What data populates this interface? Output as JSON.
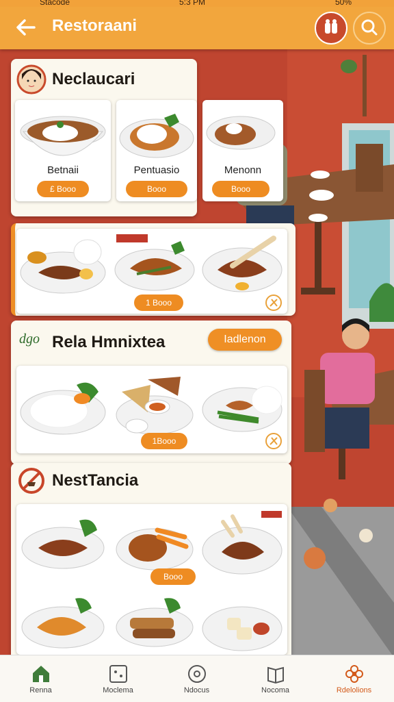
{
  "status": {
    "carrier": "Stacode",
    "time": "5:3 PM",
    "battery": "50%"
  },
  "header": {
    "title": "Restoraani"
  },
  "sections": [
    {
      "title": "Neclaucari",
      "dishes": [
        {
          "name": "Betnaii",
          "price": "£ Booo"
        },
        {
          "name": "Pentuasio",
          "price": "Booo"
        },
        {
          "name": "Menonn",
          "price": "Booo"
        }
      ]
    },
    {
      "title": "",
      "dishes": [
        {
          "name": "",
          "price": ""
        },
        {
          "name": "",
          "price": "1 Booo"
        },
        {
          "name": "",
          "price": ""
        }
      ]
    },
    {
      "title": "Rela Hmnixtea",
      "logo_text": "dgo",
      "action": "Iadlenon",
      "dishes": [
        {
          "name": "",
          "price": ""
        },
        {
          "name": "",
          "price": "1Booo"
        },
        {
          "name": "",
          "price": ""
        }
      ]
    },
    {
      "title": "NestTancia",
      "dishes": [
        {
          "name": "",
          "price": ""
        },
        {
          "name": "",
          "price": "Booo"
        },
        {
          "name": "",
          "price": ""
        },
        {
          "name": "",
          "price": ""
        },
        {
          "name": "",
          "price": ""
        },
        {
          "name": "",
          "price": ""
        }
      ]
    }
  ],
  "nav": [
    {
      "label": "Renna",
      "icon": "home-icon"
    },
    {
      "label": "Moclema",
      "icon": "grid-icon"
    },
    {
      "label": "Ndocus",
      "icon": "disc-icon"
    },
    {
      "label": "Nocoma",
      "icon": "book-icon"
    },
    {
      "label": "Rdelolions",
      "icon": "flower-icon",
      "active": true
    }
  ],
  "colors": {
    "accent": "#ef8f25",
    "header": "#f2a63d",
    "active_nav": "#d35a1a"
  }
}
